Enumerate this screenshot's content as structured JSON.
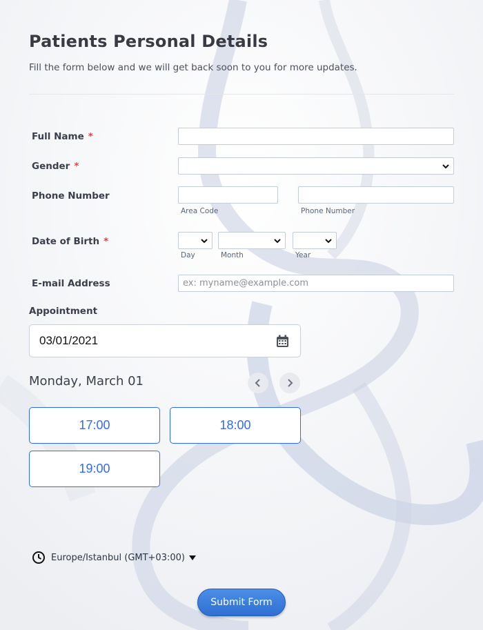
{
  "form": {
    "title": "Patients Personal Details",
    "subtitle": "Fill the form below and we will get back soon to you for more updates."
  },
  "fields": {
    "full_name": {
      "label": "Full Name",
      "required_mark": "*",
      "value": ""
    },
    "gender": {
      "label": "Gender",
      "required_mark": "*",
      "selected": ""
    },
    "phone": {
      "label": "Phone Number",
      "area_code_sublabel": "Area Code",
      "number_sublabel": "Phone Number",
      "area_code_value": "",
      "number_value": ""
    },
    "dob": {
      "label": "Date of Birth",
      "required_mark": "*",
      "day_sublabel": "Day",
      "month_sublabel": "Month",
      "year_sublabel": "Year"
    },
    "email": {
      "label": "E-mail Address",
      "placeholder": "ex: myname@example.com",
      "value": ""
    }
  },
  "appointment": {
    "label": "Appointment",
    "date_value": "03/01/2021",
    "day_heading": "Monday, March 01",
    "slots": [
      "17:00",
      "18:00",
      "19:00"
    ],
    "timezone": "Europe/Istanbul (GMT+03:00)"
  },
  "submit_label": "Submit Form",
  "colors": {
    "accent": "#2e69ff",
    "required": "#f23a3c",
    "submit_top": "#4c8ee8",
    "submit_bottom": "#2f6fd1"
  },
  "icons": {
    "calendar": "calendar-icon",
    "prev": "chevron-left-icon",
    "next": "chevron-right-icon",
    "clock": "clock-icon",
    "dropdown": "chevron-down-icon"
  }
}
